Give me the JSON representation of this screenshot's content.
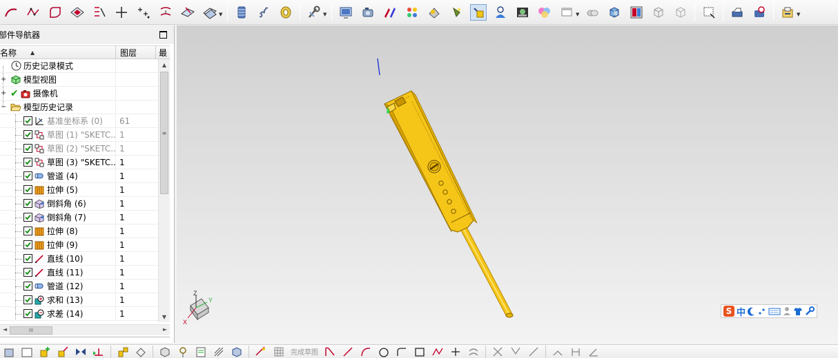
{
  "navigator": {
    "title": "部件导航器",
    "col_name": "名称",
    "col_layer": "图层",
    "col_latest": "最",
    "rows": [
      {
        "label": "历史记录模式",
        "layer": "",
        "icon": "clock-icon",
        "type": "root",
        "checked": false,
        "gray": false
      },
      {
        "label": "模型视图",
        "layer": "",
        "icon": "model-views-icon",
        "type": "root-collapsed",
        "checked": false,
        "gray": false
      },
      {
        "label": "摄像机",
        "layer": "",
        "icon": "camera-icon",
        "type": "root-collapsed-check",
        "checked": false,
        "gray": false
      },
      {
        "label": "模型历史记录",
        "layer": "",
        "icon": "folder-open-icon",
        "type": "root-expanded",
        "checked": false,
        "gray": false
      },
      {
        "label": "基准坐标系 (0)",
        "layer": "61",
        "icon": "datum-csys-icon",
        "type": "feature",
        "checked": true,
        "gray": true
      },
      {
        "label": "草图 (1) \"SKETC...",
        "layer": "1",
        "icon": "sketch-icon",
        "type": "feature",
        "checked": true,
        "gray": true
      },
      {
        "label": "草图 (2) \"SKETC...",
        "layer": "1",
        "icon": "sketch-icon",
        "type": "feature",
        "checked": true,
        "gray": true
      },
      {
        "label": "草图 (3) \"SKETC...",
        "layer": "1",
        "icon": "sketch-icon",
        "type": "feature",
        "checked": true,
        "gray": false
      },
      {
        "label": "管道 (4)",
        "layer": "1",
        "icon": "tube-icon",
        "type": "feature",
        "checked": true,
        "gray": false
      },
      {
        "label": "拉伸 (5)",
        "layer": "1",
        "icon": "extrude-icon",
        "type": "feature",
        "checked": true,
        "gray": false
      },
      {
        "label": "倒斜角 (6)",
        "layer": "1",
        "icon": "chamfer-icon",
        "type": "feature",
        "checked": true,
        "gray": false
      },
      {
        "label": "倒斜角 (7)",
        "layer": "1",
        "icon": "chamfer-icon",
        "type": "feature",
        "checked": true,
        "gray": false
      },
      {
        "label": "拉伸 (8)",
        "layer": "1",
        "icon": "extrude-icon",
        "type": "feature",
        "checked": true,
        "gray": false
      },
      {
        "label": "拉伸 (9)",
        "layer": "1",
        "icon": "extrude-icon",
        "type": "feature",
        "checked": true,
        "gray": false
      },
      {
        "label": "直线 (10)",
        "layer": "1",
        "icon": "line-icon",
        "type": "feature",
        "checked": true,
        "gray": false
      },
      {
        "label": "直线 (11)",
        "layer": "1",
        "icon": "line-icon",
        "type": "feature",
        "checked": true,
        "gray": false
      },
      {
        "label": "管道 (12)",
        "layer": "1",
        "icon": "tube-icon",
        "type": "feature",
        "checked": true,
        "gray": false
      },
      {
        "label": "求和 (13)",
        "layer": "1",
        "icon": "unite-icon",
        "type": "feature",
        "checked": true,
        "gray": false
      },
      {
        "label": "求差 (14)",
        "layer": "1",
        "icon": "subtract-icon",
        "type": "feature",
        "checked": true,
        "gray": false
      }
    ]
  },
  "hscroll_glyph": "III",
  "vscroll_glyph": "≡",
  "viewport": {
    "triad": {
      "z": "Z",
      "x": "X",
      "y": "Y"
    },
    "model_color": "#f5c518",
    "background_top": "#cfcfcf",
    "background_bottom": "#f3f3f3"
  },
  "ime": {
    "logo": "S",
    "mode": "中",
    "items": [
      "moon-icon",
      "punctuation-icon",
      "keyboard-icon",
      "user-icon",
      "shirt-icon",
      "wrench-icon"
    ]
  },
  "toolbar_top": {
    "buttons": [
      "arc-icon",
      "studio-spline-icon",
      "fillet-curve-icon",
      "rectangle-icon",
      "sketch-curve-icon",
      "point-icon",
      "point-set-icon",
      "offset-curve-icon",
      "datum-plane-icon",
      "datum-axis-icon",
      "layer-icon",
      "spring-icon",
      "coil-icon",
      "spanner-icon",
      "screen-icon",
      "camera-view-icon",
      "edit-display-icon",
      "color-palette-icon",
      "lights-icon",
      "cone-light-icon",
      "highlight-icon",
      "user-role-icon",
      "image-icon",
      "colors-icon",
      "window-icon",
      "clouds-icon",
      "cube-icon",
      "layout-icon",
      "grid-cube-icon",
      "wire-cube-icon",
      "select-window-icon",
      "printer-icon",
      "hand-tool-icon",
      "export-icon"
    ],
    "active": "highlight-icon"
  },
  "toolbar_bottom": {
    "finish_sketch": "完成草图"
  }
}
